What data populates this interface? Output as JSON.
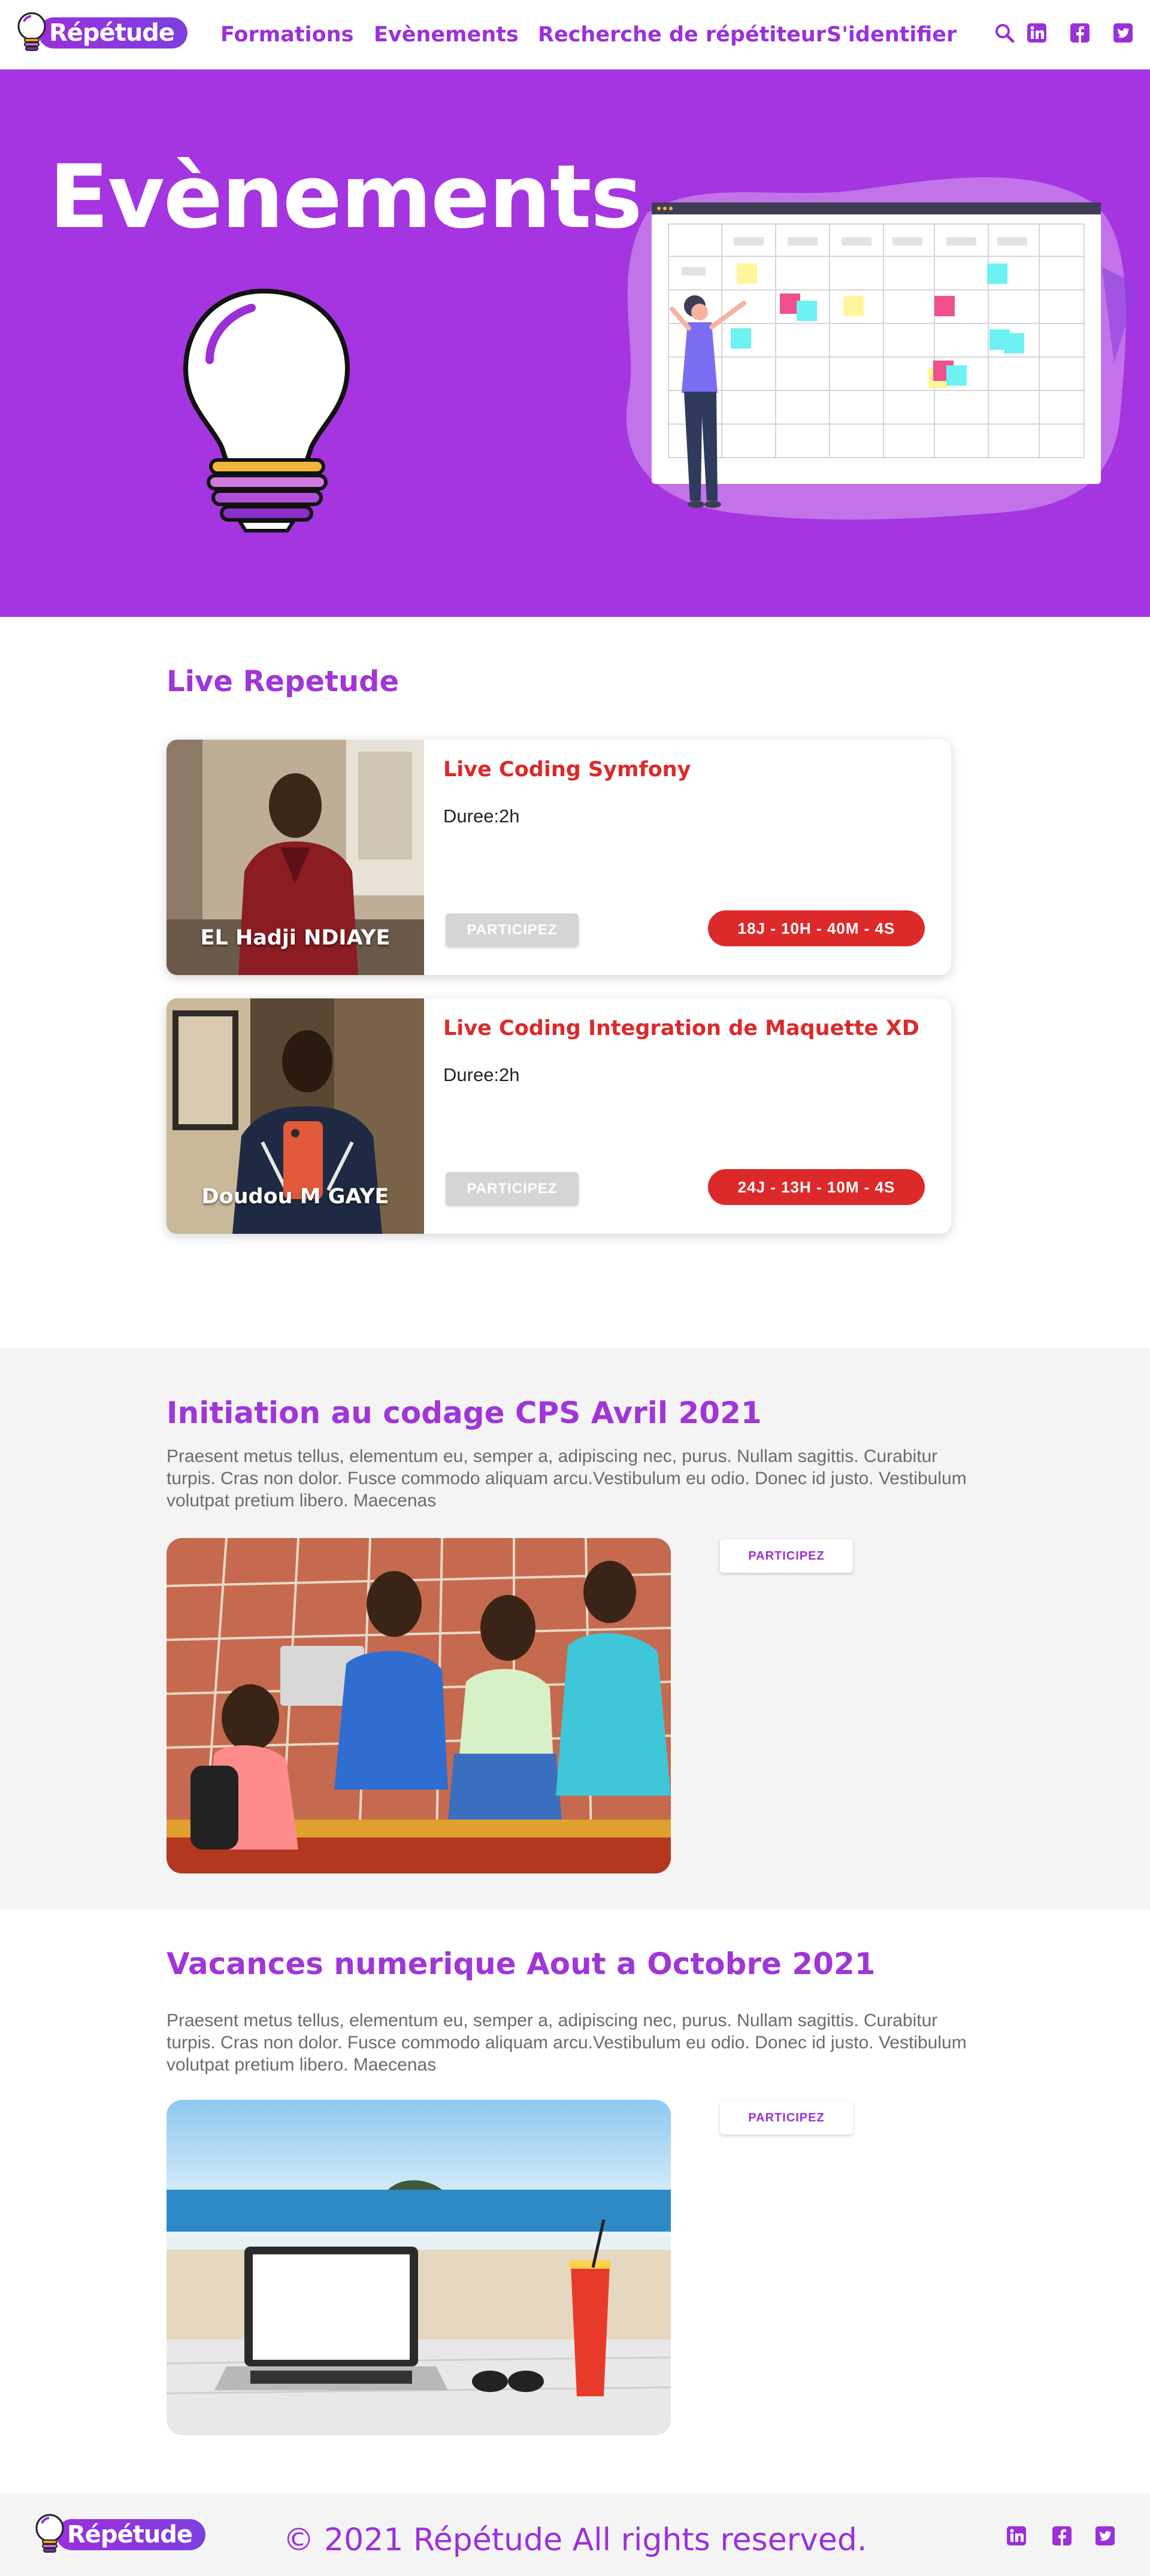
{
  "brand": {
    "name": "Répétude"
  },
  "nav": {
    "items": [
      {
        "label": "Formations"
      },
      {
        "label": "Evènements"
      },
      {
        "label": "Recherche de répétiteur"
      },
      {
        "label": "S'identifier"
      }
    ],
    "icons": [
      "search-icon",
      "linkedin-icon",
      "facebook-icon",
      "twitter-icon"
    ]
  },
  "hero": {
    "title": "Evènements"
  },
  "live": {
    "heading": "Live Repetude",
    "cards": [
      {
        "presenter": "EL Hadji NDIAYE",
        "title": "Live Coding Symfony",
        "duration": "Duree:2h",
        "button": "PARTICIPEZ",
        "countdown": "18J - 10H - 40M - 4S"
      },
      {
        "presenter": "Doudou M GAYE",
        "title": "Live Coding Integration de Maquette XD",
        "duration": "Duree:2h",
        "button": "PARTICIPEZ",
        "countdown": "24J - 13H - 10M - 4S"
      }
    ]
  },
  "events": [
    {
      "title": "Initiation au codage CPS Avril 2021",
      "description": "Praesent metus tellus, elementum eu, semper a, adipiscing nec, purus. Nullam sagittis. Curabitur turpis. Cras non dolor. Fusce commodo aliquam arcu.Vestibulum eu odio. Donec id justo. Vestibulum volutpat pretium libero. Maecenas",
      "button": "PARTICIPEZ"
    },
    {
      "title": "Vacances numerique Aout a Octobre 2021",
      "description": "Praesent metus tellus, elementum eu, semper a, adipiscing nec, purus. Nullam sagittis. Curabitur turpis. Cras non dolor. Fusce commodo aliquam arcu.Vestibulum eu odio. Donec id justo. Vestibulum volutpat pretium libero. Maecenas",
      "button": "PARTICIPEZ"
    }
  ],
  "footer": {
    "copyright": "© 2021 Répétude All rights reserved.",
    "icons": [
      "linkedin-icon",
      "facebook-icon",
      "twitter-icon"
    ]
  },
  "colors": {
    "brand_purple": "#a535e0",
    "accent_red": "#dc2a2a",
    "band_grey": "#f4f4f4"
  }
}
